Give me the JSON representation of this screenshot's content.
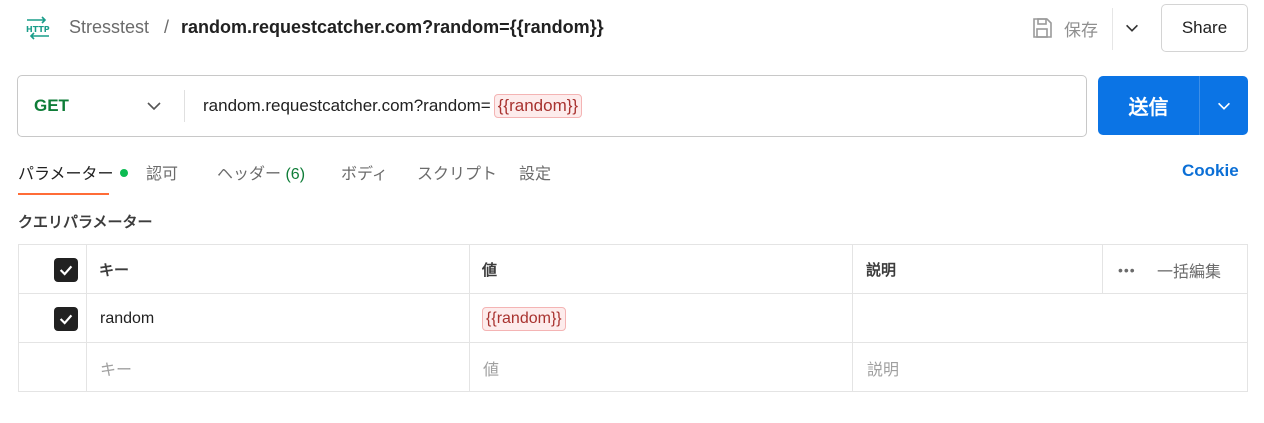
{
  "header": {
    "breadcrumb_parent": "Stresstest",
    "breadcrumb_separator": "/",
    "request_name": "random.requestcatcher.com?random={{random}}",
    "save_label": "保存",
    "share_label": "Share"
  },
  "request": {
    "method": "GET",
    "url_text": "random.requestcatcher.com?random=",
    "url_variable": "{{random}}",
    "send_label": "送信"
  },
  "tabs": {
    "params": "パラメーター",
    "auth": "認可",
    "headers": "ヘッダー",
    "headers_count": "(6)",
    "body": "ボディ",
    "scripts": "スクリプト",
    "settings": "設定",
    "cookie": "Cookie"
  },
  "query_params": {
    "title": "クエリパラメーター",
    "headers": {
      "key": "キー",
      "value": "値",
      "description": "説明",
      "more": "•••",
      "bulk_edit": "一括編集"
    },
    "rows": [
      {
        "enabled": true,
        "key": "random",
        "value": "{{random}}",
        "description": ""
      }
    ],
    "placeholders": {
      "key": "キー",
      "value": "値",
      "description": "説明"
    }
  },
  "colors": {
    "method_get": "#0f7d38",
    "send_button": "#0b74e5",
    "active_tab_underline": "#ff6c37",
    "status_dot": "#0cbb52",
    "variable_bg": "#fdecec",
    "variable_text": "#a8322f",
    "link": "#0b6fd6"
  },
  "icons": [
    "http-icon",
    "save-icon",
    "chevron-down-icon",
    "checkbox-checked-icon",
    "more-icon"
  ]
}
